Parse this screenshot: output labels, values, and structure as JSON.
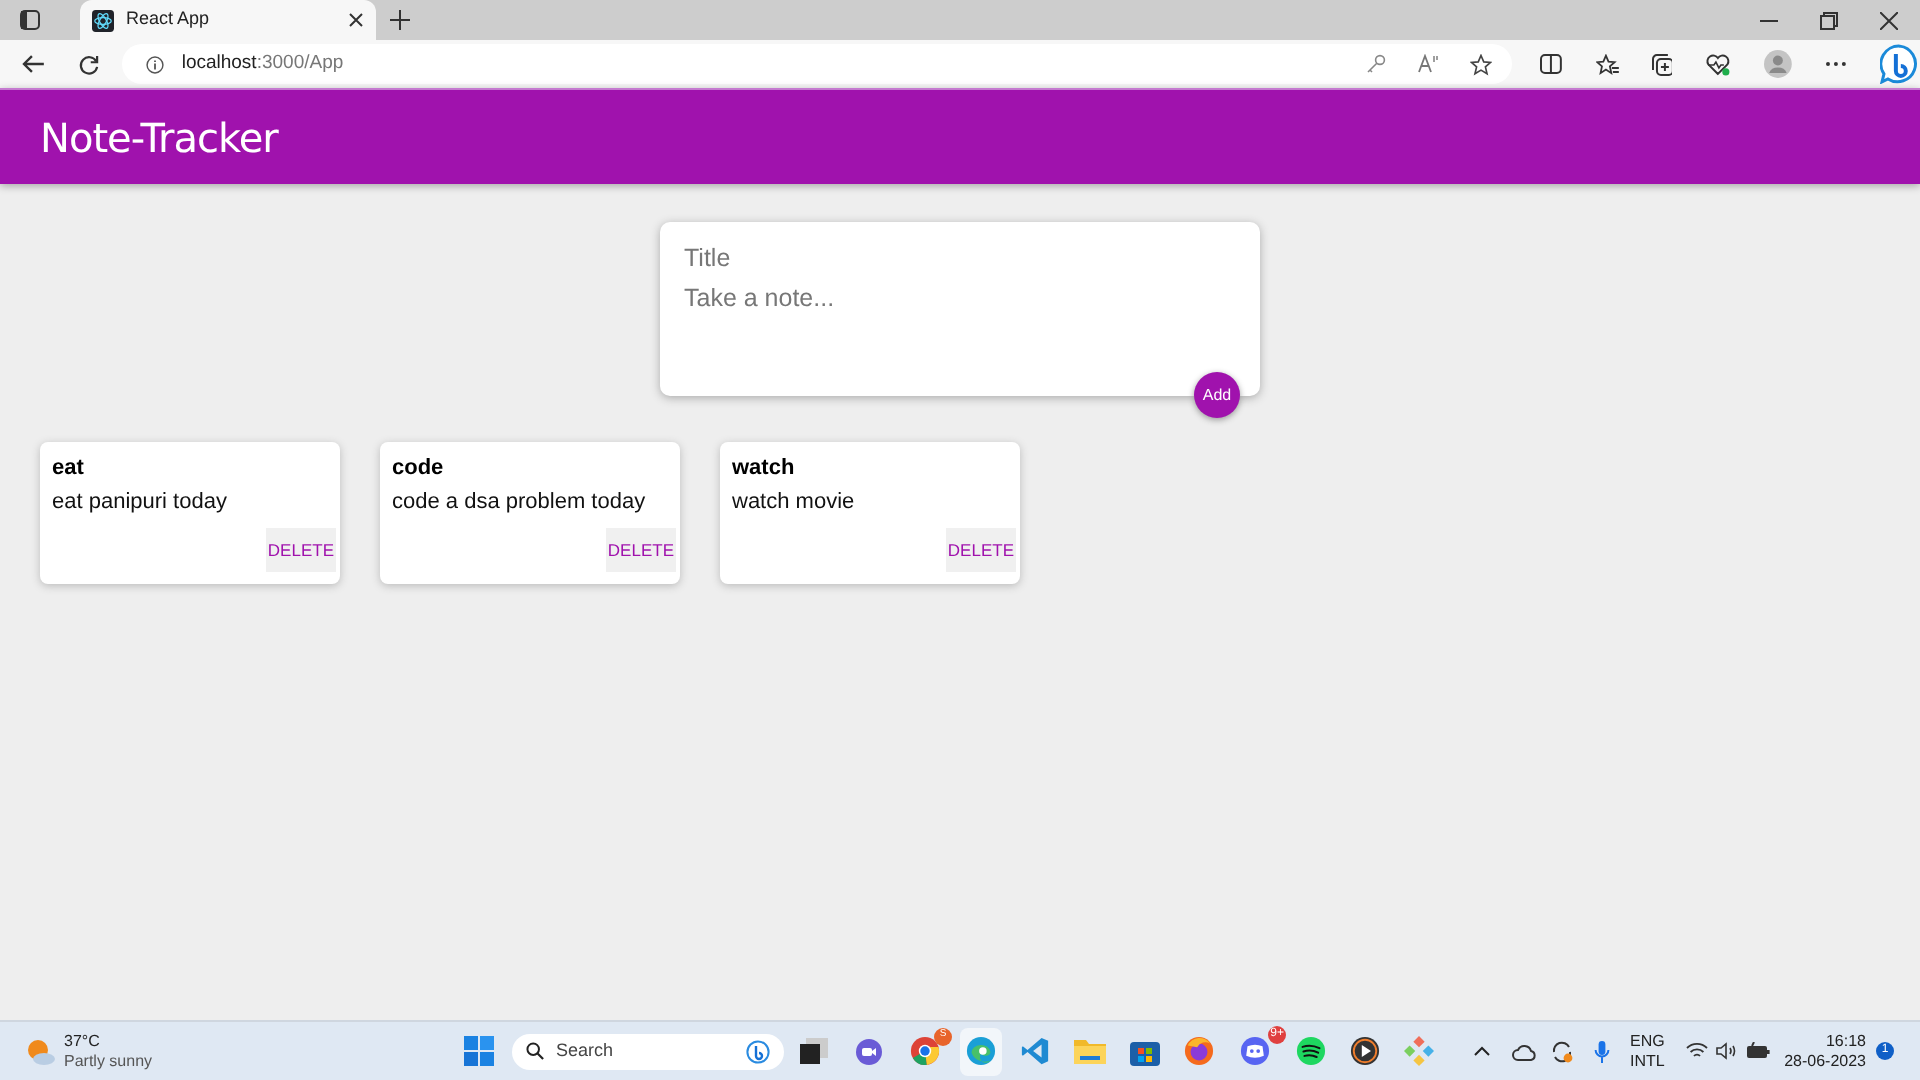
{
  "browser": {
    "tab": {
      "title": "React App",
      "selected": true
    },
    "url": "**localhost**:3000/App"
  },
  "header": {
    "title": "Note-Tracker"
  },
  "create_note": {
    "title_placeholder": "Title",
    "content_placeholder": "Take a note...",
    "add_button": "Add"
  },
  "notes": [
    {
      "title": "eat",
      "content": "eat panipuri today",
      "delete_button": "DELETE"
    },
    {
      "title": "code",
      "content": "code a dsa problem today",
      "delete_button": "DELETE"
    },
    {
      "title": "watch",
      "content": "watch movie",
      "delete_button": "DELETE"
    }
  ],
  "taskbar": {
    "weather": {
      "temperature": "37°C",
      "condition": "Partly sunny"
    },
    "search_placeholder": "Search",
    "chrome_badge": "S",
    "discord_badge": "9+",
    "language": "ENG",
    "layout": "INTL",
    "time": "16:18",
    "date": "28-06-2023",
    "notifications": "1"
  }
}
